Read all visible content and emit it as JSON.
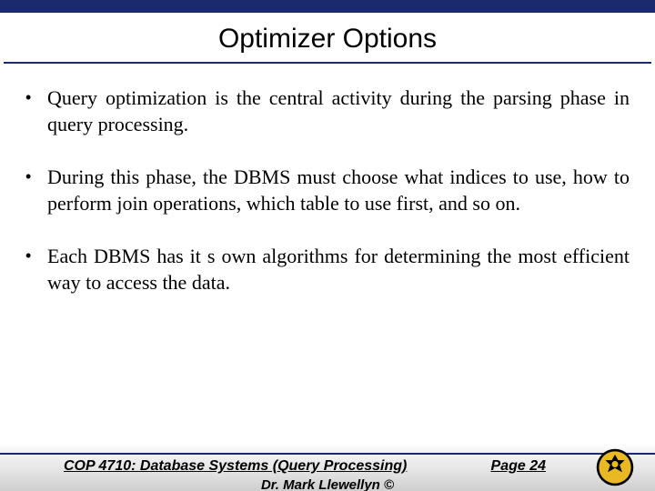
{
  "title": "Optimizer Options",
  "bullets": [
    "Query optimization is the central activity during the parsing phase in query processing.",
    "During this phase, the DBMS must choose what indices to use, how to perform join operations, which table to use first, and so on.",
    "Each DBMS has it s own algorithms for determining the most efficient way to access the data."
  ],
  "footer": {
    "course": "COP 4710: Database Systems (Query Processing)",
    "page": "Page 24",
    "author": "Dr. Mark Llewellyn ©"
  }
}
